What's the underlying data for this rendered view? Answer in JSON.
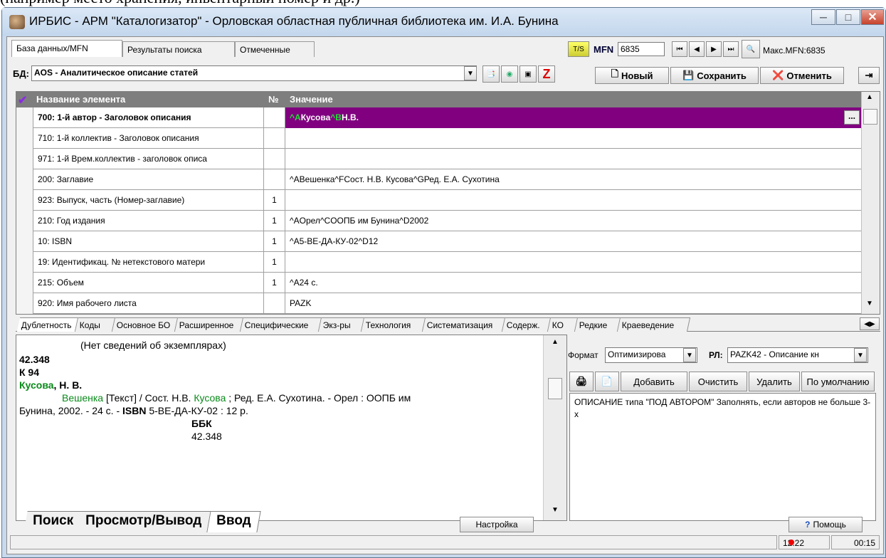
{
  "doc_top_text": "(например место хранения, инвентарный номер и др.)",
  "window": {
    "title": "ИРБИС - АРМ \"Каталогизатор\" - Орловская областная публичная библиотека им. И.А. Бунина"
  },
  "tabs": [
    "База данных/MFN",
    "Результаты поиска",
    "Отмеченные"
  ],
  "mfn": {
    "label": "MFN",
    "value": "6835",
    "max_label": "Макс.MFN:6835"
  },
  "db": {
    "label": "БД:",
    "value": "AOS - Аналитическое описание статей"
  },
  "toolbar": {
    "new_label": "Новый",
    "save_label": "Сохранить",
    "cancel_label": "Отменить"
  },
  "grid": {
    "headers": [
      "Название элемента",
      "№",
      "Значение"
    ],
    "rows": [
      {
        "name": "700: 1-й автор - Заголовок описания",
        "num": "",
        "value_parts": [
          "^A",
          "Кусова",
          "^B",
          "Н.В."
        ]
      },
      {
        "name": "710: 1-й коллектив - Заголовок описания",
        "num": "",
        "value": ""
      },
      {
        "name": "971: 1-й Врем.коллектив - заголовок описа",
        "num": "",
        "value": ""
      },
      {
        "name": "200: Заглавие",
        "num": "",
        "value": "^AВешенка^FСост. Н.В. Кусова^GРед. Е.А. Сухотина"
      },
      {
        "name": "923: Выпуск, часть (Номер-заглавие)",
        "num": "1",
        "value": ""
      },
      {
        "name": "210: Год издания",
        "num": "1",
        "value": "^AОрел^CООПБ им Бунина^D2002"
      },
      {
        "name": "10: ISBN",
        "num": "1",
        "value": "^A5-ВЕ-ДА-КУ-02^D12"
      },
      {
        "name": "19: Идентификац. № нетекстового матери",
        "num": "1",
        "value": ""
      },
      {
        "name": "215: Объем",
        "num": "1",
        "value": "^A24 с."
      },
      {
        "name": "920: Имя рабочего листа",
        "num": "",
        "value": "PAZK"
      }
    ],
    "ellipsis": "..."
  },
  "bottom_tabs": [
    "Дублетность",
    "Коды",
    "Основное БО",
    "Расширенное",
    "Специфические",
    "Экз-ры",
    "Технология",
    "Систематизация",
    "Содерж.",
    "КО",
    "Редкие",
    "Краеведение"
  ],
  "preview": {
    "no_copies": "(Нет сведений об экземплярах)",
    "index1": "42.348",
    "index2": "К 94",
    "author_surname": "Кусова",
    "author_initials": ", Н. В.",
    "l1_title": "Вешенка",
    "l1_mid": " [Текст] / Сост. Н.В. ",
    "l1_author": "Кусова",
    "l1_tail": " ; Ред. Е.А. Сухотина. - Орел : ООПБ им",
    "l2_head": "Бунина, 2002. - 24 с. - ",
    "l2_isbn_label": "ISBN",
    "l2_tail": " 5-ВЕ-ДА-КУ-02 : 12 р.",
    "bbk_label": "ББК",
    "bbk_value": "42.348"
  },
  "format": {
    "label": "Формат",
    "value": "Оптимизирова",
    "rl_label": "РЛ:",
    "rl_value": "PAZK42 - Описание кн"
  },
  "actions": {
    "add": "Добавить",
    "clear": "Очистить",
    "delete": "Удалить",
    "default": "По умолчанию"
  },
  "description": "ОПИСАНИЕ типа \"ПОД АВТОРОМ\"     Заполнять, если авторов не больше 3-х",
  "main_tabs": [
    "Поиск",
    "Просмотр/Вывод",
    "Ввод"
  ],
  "settings_label": "Настройка",
  "help_label": "Помощь",
  "status": {
    "left": "12:22",
    "right": "00:15"
  }
}
